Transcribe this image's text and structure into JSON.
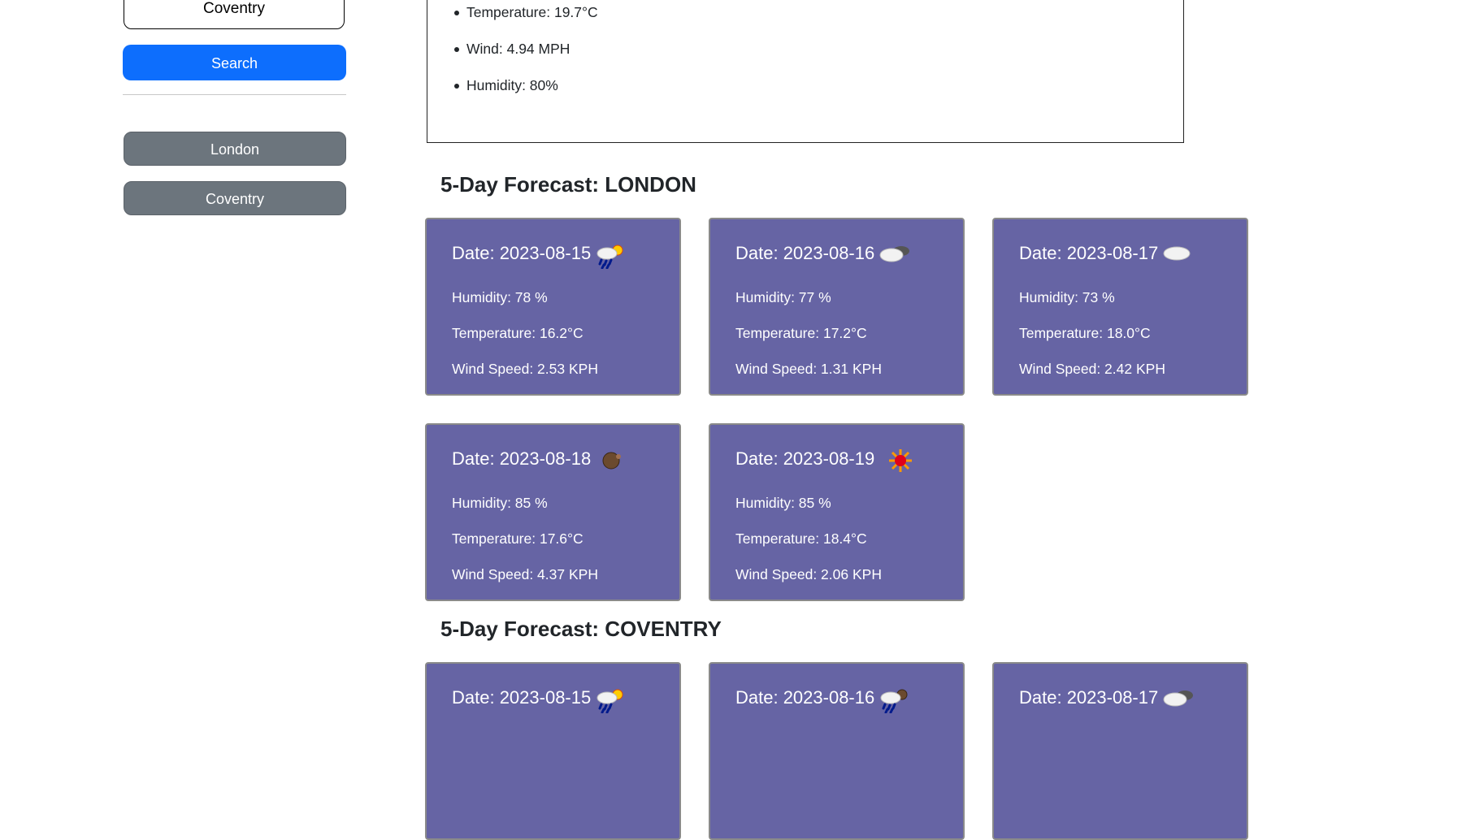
{
  "sidebar": {
    "search_value": "Coventry",
    "search_button_label": "Search",
    "history": [
      "London",
      "Coventry"
    ]
  },
  "current": {
    "temperature": "Temperature: 19.7°C",
    "wind": "Wind: 4.94 MPH",
    "humidity": "Humidity: 80%"
  },
  "forecasts": [
    {
      "title": "5-Day Forecast: LONDON",
      "days": [
        {
          "date": "Date: 2023-08-15",
          "icon": "rain-sun-icon",
          "humidity": "Humidity: 78 %",
          "temperature": "Temperature: 16.2°C",
          "wind": "Wind Speed: 2.53 KPH"
        },
        {
          "date": "Date: 2023-08-16",
          "icon": "cloud-icon",
          "humidity": "Humidity: 77 %",
          "temperature": "Temperature: 17.2°C",
          "wind": "Wind Speed: 1.31 KPH"
        },
        {
          "date": "Date: 2023-08-17",
          "icon": "cloud-icon",
          "humidity": "Humidity: 73 %",
          "temperature": "Temperature: 18.0°C",
          "wind": "Wind Speed: 2.42 KPH"
        },
        {
          "date": "Date: 2023-08-18",
          "icon": "moon-icon",
          "humidity": "Humidity: 85 %",
          "temperature": "Temperature: 17.6°C",
          "wind": "Wind Speed: 4.37 KPH"
        },
        {
          "date": "Date: 2023-08-19",
          "icon": "sun-icon",
          "humidity": "Humidity: 85 %",
          "temperature": "Temperature: 18.4°C",
          "wind": "Wind Speed: 2.06 KPH"
        }
      ]
    },
    {
      "title": "5-Day Forecast: COVENTRY",
      "days": [
        {
          "date": "Date: 2023-08-15",
          "icon": "rain-sun-icon"
        },
        {
          "date": "Date: 2023-08-16",
          "icon": "rain-moon-icon"
        },
        {
          "date": "Date: 2023-08-17",
          "icon": "cloud-icon"
        }
      ]
    }
  ],
  "colors": {
    "card_bg": "#6664a4",
    "search_button": "#0d6efd",
    "history_button": "#6c757d"
  }
}
